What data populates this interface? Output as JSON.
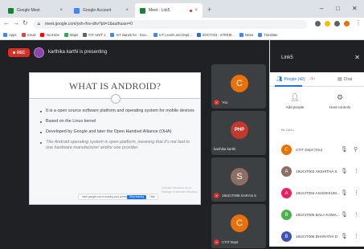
{
  "browser": {
    "tabs": [
      {
        "label": "Google Meet",
        "color": "#188038"
      },
      {
        "label": "Google Account",
        "color": "#4285f4"
      },
      {
        "label": "Meet - Lnk5",
        "color": "#188038"
      }
    ],
    "tab_close": "×",
    "new_tab": "+",
    "url": "meet.google.com/yxh-rfxv-dhv?pli=1&authuser=0",
    "bookmarks": [
      "Apps",
      "Gmail",
      "YouTube",
      "Maps",
      "IOT UNIT 1",
      "IoT stands for - Goo...",
      "IoT Levels and Depl...",
      "20ICT015 - STEEM...",
      "News",
      "Translate"
    ]
  },
  "meet": {
    "rec_label": "REC",
    "presenting_text": "karthika karthi is presenting",
    "slide": {
      "title": "WHAT IS ANDROID?",
      "bullets": [
        "It is a open source software platform and operating system for mobile devices",
        "Based on the Linux kernel",
        "Developed by Google and later the Open Handset Alliance (OHA)"
      ],
      "italic_bullet": "The Android operating system is open platform, meaning that it's not tied to one hardware manufacturer and/or one provider.",
      "share_bar_text": "meet.google.com is sharing your screen.",
      "stop_label": "Stop sharing",
      "hide_label": "Hide",
      "watermark": "Activate Windows Go to Settings to activate Windows."
    },
    "tiles": [
      {
        "initial": "C",
        "name": "You",
        "color": "#e8710a"
      },
      {
        "initial": "PHP",
        "name": "karthika karthi",
        "color": "#c0392b"
      },
      {
        "initial": "S",
        "name": "19UCIT008 SARAN S",
        "color": "#8d6e63"
      },
      {
        "initial": "C",
        "name": "CTIT Dept",
        "color": "#e8710a"
      }
    ]
  },
  "panel": {
    "title": "Link5",
    "tabs": {
      "people": "People (42)",
      "chat": "Chat"
    },
    "actions": {
      "add": "Add people",
      "host": "Host controls"
    },
    "section": "IN CALL",
    "people": [
      {
        "initial": "C",
        "name": "CTIT Dept (You)",
        "color": "#e8710a"
      },
      {
        "initial": "A",
        "name": "19UCIT002 AKSHITHA S",
        "color": "#8d6e63"
      },
      {
        "initial": "A",
        "name": "19UCIT004 ASHOKKUM...",
        "color": "#e91e63"
      },
      {
        "initial": "B",
        "name": "19UCIT005 BALA KUMA...",
        "color": "#4caf50"
      },
      {
        "initial": "B",
        "name": "19UCIT006 BHARATHI D",
        "color": "#3f51b5"
      }
    ]
  }
}
